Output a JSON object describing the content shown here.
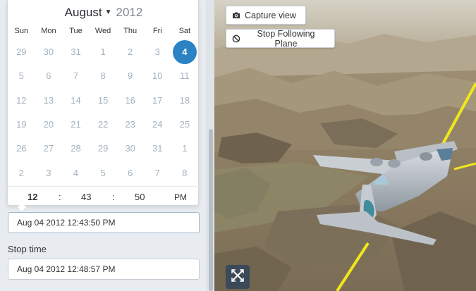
{
  "calendar": {
    "month": "August",
    "year": "2012",
    "weekdays": [
      "Sun",
      "Mon",
      "Tue",
      "Wed",
      "Thu",
      "Fri",
      "Sat"
    ],
    "weeks": [
      [
        "29",
        "30",
        "31",
        "1",
        "2",
        "3",
        "4"
      ],
      [
        "5",
        "6",
        "7",
        "8",
        "9",
        "10",
        "11"
      ],
      [
        "12",
        "13",
        "14",
        "15",
        "16",
        "17",
        "18"
      ],
      [
        "19",
        "20",
        "21",
        "22",
        "23",
        "24",
        "25"
      ],
      [
        "26",
        "27",
        "28",
        "29",
        "30",
        "31",
        "1"
      ],
      [
        "2",
        "3",
        "4",
        "5",
        "6",
        "7",
        "8"
      ]
    ],
    "selected_day": "4",
    "time": {
      "hour": "12",
      "minute": "43",
      "second": "50",
      "ampm": "PM",
      "separator": ":"
    }
  },
  "start_time": {
    "value": "Aug 04 2012 12:43:50 PM"
  },
  "stop_time": {
    "label": "Stop time",
    "value": "Aug 04 2012 12:48:57 PM"
  },
  "view": {
    "capture_label": "Capture view",
    "stop_following_label": "Stop Following Plane",
    "capture_icon": "camera-icon",
    "stop_icon": "ban-icon",
    "exit_icon": "exit-fullscreen-icon"
  },
  "colors": {
    "accent": "#2b82c4",
    "flight_path": "#f0e81a",
    "panel_bg": "#e8ecf0"
  }
}
